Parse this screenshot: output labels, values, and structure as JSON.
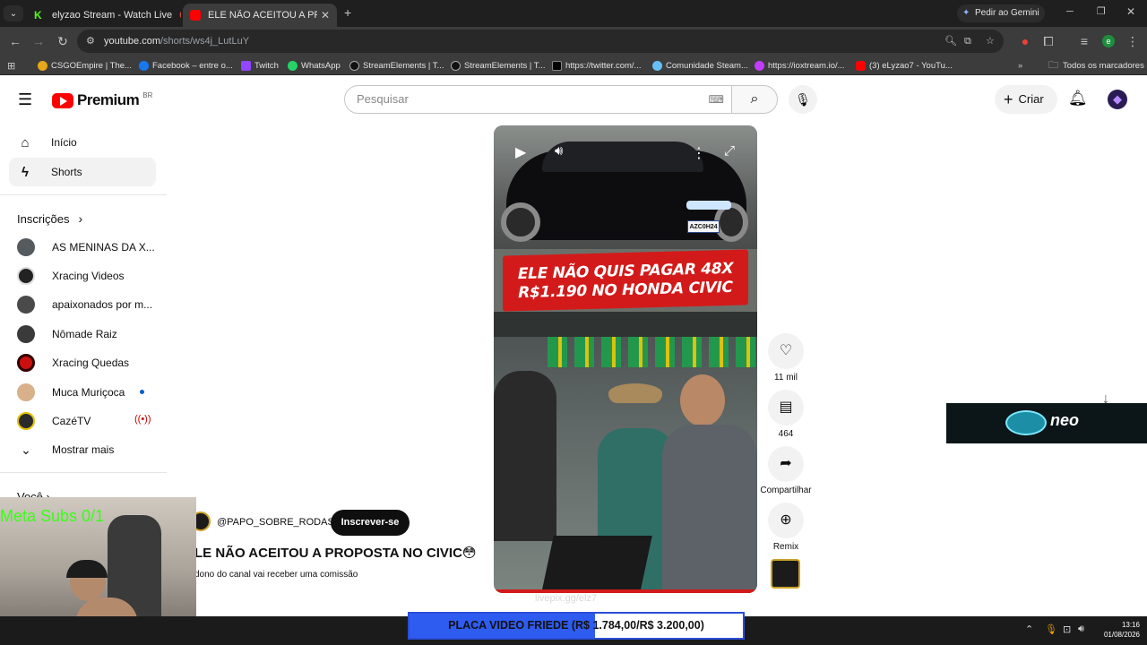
{
  "browser": {
    "tabs": [
      {
        "title": "elyzao Stream - Watch Live",
        "favicon_color": "#53fc18"
      },
      {
        "title": "ELE NÃO ACEITOU A PROPOSTA",
        "favicon_color": "#ff0000"
      }
    ],
    "gemini_label": "Pedir ao Gemini",
    "url_host": "youtube.com",
    "url_path": "/shorts/ws4j_LutLuY",
    "bookmarks": [
      {
        "label": "CSGOEmpire | The...",
        "color": "#e6a817"
      },
      {
        "label": "Facebook – entre o...",
        "color": "#1877f2"
      },
      {
        "label": "Twitch",
        "color": "#9146ff"
      },
      {
        "label": "WhatsApp",
        "color": "#25d366"
      },
      {
        "label": "StreamElements | T...",
        "color": "#111111"
      },
      {
        "label": "StreamElements | T...",
        "color": "#111111"
      },
      {
        "label": "https://twitter.com/...",
        "color": "#000000"
      },
      {
        "label": "Comunidade Steam...",
        "color": "#1b2838"
      },
      {
        "label": "https://ioxtream.io/...",
        "color": "#c13cff"
      },
      {
        "label": "(3) eLyzao7 - YouTu...",
        "color": "#ff0000"
      }
    ],
    "bookmarks_folder": "Todos os marcadores"
  },
  "youtube": {
    "logo_text": "Premium",
    "logo_region": "BR",
    "search_placeholder": "Pesquisar",
    "create_label": "Criar",
    "nav": [
      {
        "label": "Início"
      },
      {
        "label": "Shorts"
      }
    ],
    "subscriptions_title": "Inscrições",
    "subscriptions": [
      {
        "name": "AS MENINAS DA X...",
        "color": "#555a5f"
      },
      {
        "name": "Xracing Videos",
        "color": "#222222"
      },
      {
        "name": "apaixonados por m...",
        "color": "#4a4a4a"
      },
      {
        "name": "Nômade Raiz",
        "color": "#3a3a3a"
      },
      {
        "name": "Xracing Quedas",
        "color": "#cc1010"
      },
      {
        "name": "Muca Muriçoca",
        "color": "#d8b08a"
      },
      {
        "name": "CazéTV",
        "color": "#2a2a2a"
      }
    ],
    "show_more": "Mostrar mais",
    "you_section": "Você"
  },
  "short": {
    "headline_line1": "ELE NÃO QUIS PAGAR 48X",
    "headline_line2": "R$1.190 NO HONDA CIVIC",
    "plate": "AZC0H24",
    "channel": "@PAPO_SOBRE_RODAS",
    "subscribe_label": "Inscrever-se",
    "title": "LE NÃO ACEITOU A PROPOSTA NO CIVIC😳",
    "subtitle": "dono do canal vai receber uma comissão",
    "likes": "11 mil",
    "comments": "464",
    "share_label": "Compartilhar",
    "remix_label": "Remix"
  },
  "overlay": {
    "meta_subs": "Meta Subs 0/1",
    "goal_text": "PLACA VIDEO FRIEDE (R$ 1.784,00/R$ 3.200,00)",
    "goal_progress": 0.5575,
    "brand_text": "neo",
    "watermark": "livepix.gg/elz7"
  },
  "taskbar": {
    "time": "13:16",
    "date": "01/08/2026"
  }
}
